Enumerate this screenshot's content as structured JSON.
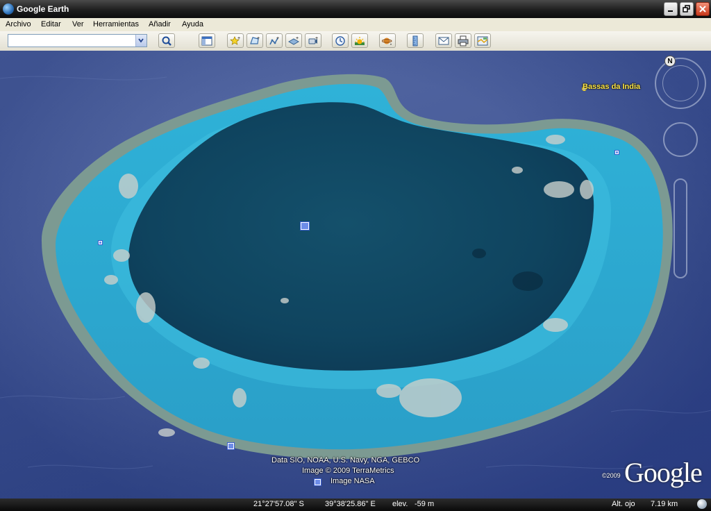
{
  "window": {
    "title": "Google Earth"
  },
  "menu": {
    "items": [
      "Archivo",
      "Editar",
      "Ver",
      "Herramientas",
      "Añadir",
      "Ayuda"
    ]
  },
  "search": {
    "value": ""
  },
  "map": {
    "place_label": "Bassas da India",
    "attribution": [
      "Data SIO, NOAA, U.S. Navy, NGA, GEBCO",
      "Image © 2009 TerraMetrics",
      "Image NASA"
    ],
    "logo_year": "©2009",
    "logo": "Google"
  },
  "compass": {
    "north": "N"
  },
  "status": {
    "lat": "21°27'57.08\" S",
    "lon": "39°38'25.86\" E",
    "elev_label": "elev.",
    "elev_value": "-59 m",
    "eye_label": "Alt. ojo",
    "eye_value": "7.19 km"
  },
  "colors": {
    "ocean": "#4b5f9c",
    "lagoon": "#114a66",
    "reef": "#2aa7cc",
    "place_label": "#ffe84a"
  }
}
